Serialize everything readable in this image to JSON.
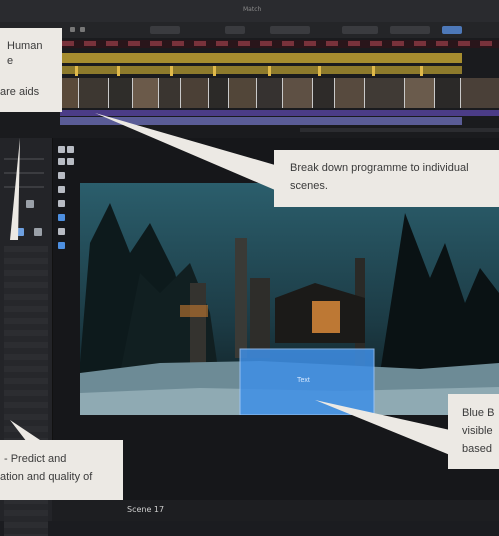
{
  "window_title": "Match",
  "callouts": {
    "top_left": {
      "line1": "Human",
      "line2": "e",
      "line3": "are aids"
    },
    "center_right": {
      "line1": "Break down programme to individual",
      "line2": "scenes."
    },
    "bottom_right": {
      "line1": "Blue B",
      "line2": "visible",
      "line3": "based"
    },
    "bottom_left": {
      "line1": "- Predict and",
      "line2": "ation and quality of"
    }
  },
  "overlay_box": {
    "label": "Text"
  },
  "status_bar": {
    "label": "Scene 17"
  },
  "colors": {
    "timeline_yellow": "#a68d2f",
    "timeline_purple": "#4b3c87",
    "overlay_blue": "#3f8fe6",
    "callout_bg": "#ece9e4"
  }
}
